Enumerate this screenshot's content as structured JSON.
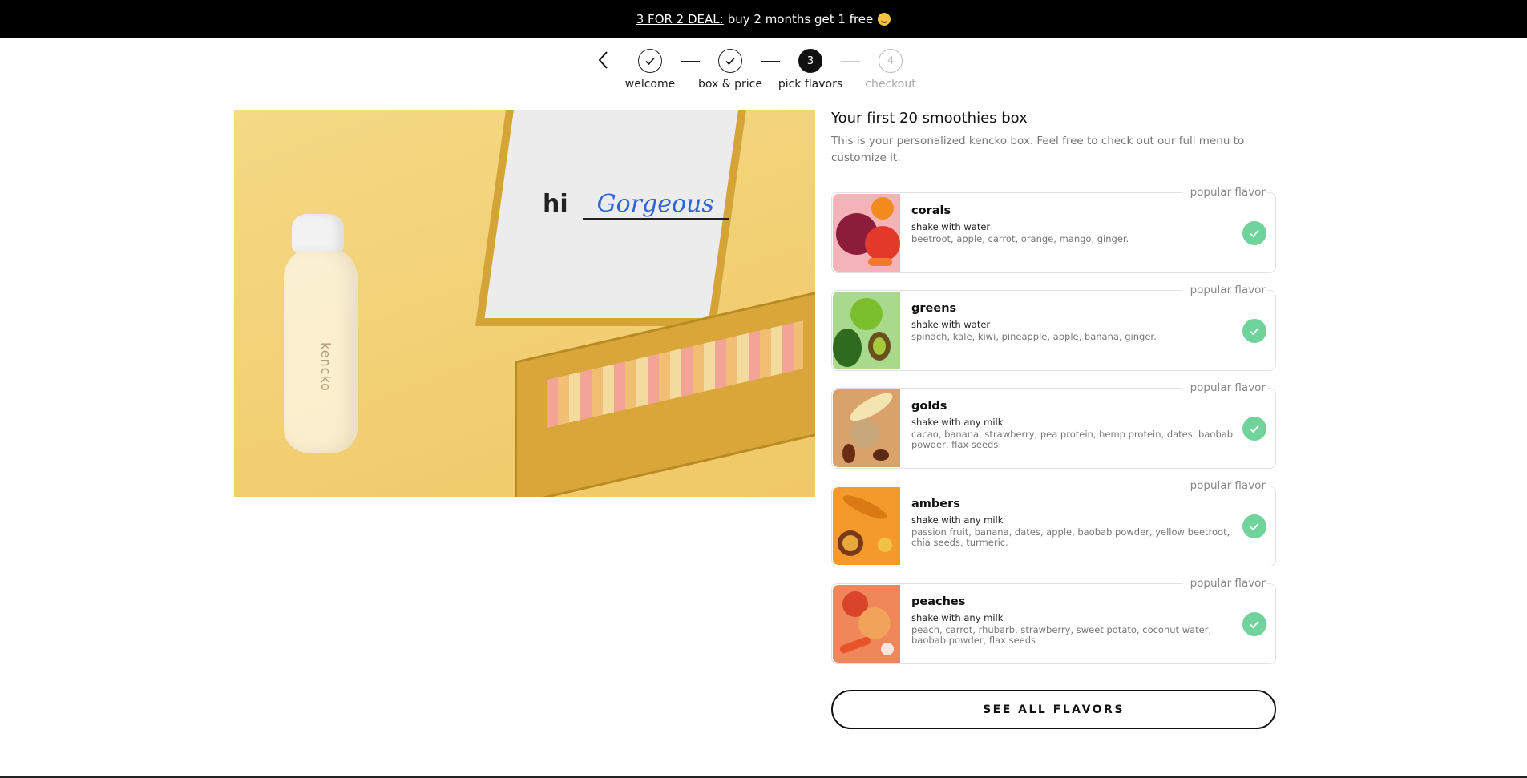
{
  "promo": {
    "deal_label": "3 FOR 2 DEAL:",
    "text": "buy 2 months get 1 free"
  },
  "stepper": {
    "steps": [
      {
        "label": "welcome",
        "state": "done"
      },
      {
        "label": "box & price",
        "state": "done"
      },
      {
        "label": "pick flavors",
        "number": "3",
        "state": "active"
      },
      {
        "label": "checkout",
        "number": "4",
        "state": "pending"
      }
    ]
  },
  "hero": {
    "greeting": "hi",
    "name": "Gorgeous",
    "bottle_brand": "kencko"
  },
  "panel": {
    "title": "Your first 20 smoothies box",
    "intro": "This is your personalized kencko box. Feel free to check out our full menu to customize it."
  },
  "flavors": [
    {
      "tag": "popular flavor",
      "name": "corals",
      "shake": "shake with water",
      "ingredients": "beetroot, apple, carrot, orange, mango, ginger."
    },
    {
      "tag": "popular flavor",
      "name": "greens",
      "shake": "shake with water",
      "ingredients": "spinach, kale, kiwi, pineapple, apple, banana, ginger."
    },
    {
      "tag": "popular flavor",
      "name": "golds",
      "shake": "shake with any milk",
      "ingredients": "cacao, banana, strawberry, pea protein, hemp protein, dates, baobab powder, flax seeds"
    },
    {
      "tag": "popular flavor",
      "name": "ambers",
      "shake": "shake with any milk",
      "ingredients": "passion fruit, banana, dates, apple, baobab powder, yellow beetroot, chia seeds, turmeric."
    },
    {
      "tag": "popular flavor",
      "name": "peaches",
      "shake": "shake with any milk",
      "ingredients": "peach, carrot, rhubarb, strawberry, sweet potato, coconut water, baobab powder, flax seeds"
    }
  ],
  "see_all_label": "SEE ALL FLAVORS",
  "colors": {
    "promo_bg": "#000000",
    "check_green": "#6fd39b",
    "hero_bg": "#f3d27a"
  }
}
